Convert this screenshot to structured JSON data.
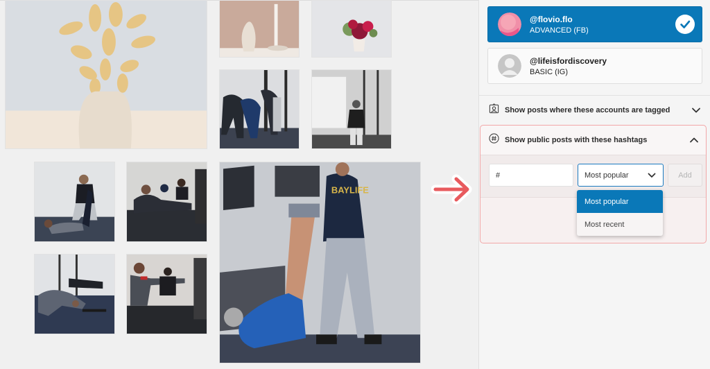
{
  "gallery": {
    "tiles": [
      {
        "name": "pampas-vase-photo"
      },
      {
        "name": "vase-candle-photo"
      },
      {
        "name": "flower-bouquet-photo"
      },
      {
        "name": "gym-stretch-group-photo"
      },
      {
        "name": "whiteboard-trainer-photo"
      },
      {
        "name": "assisted-stretch-photo"
      },
      {
        "name": "seated-reach-photo"
      },
      {
        "name": "trainer-leg-stretch-photo",
        "shirt_text": "BAYLIFE"
      },
      {
        "name": "floor-stretch-row-photo"
      },
      {
        "name": "woman-reach-photo"
      }
    ]
  },
  "accounts": [
    {
      "handle": "@flovio.flo",
      "type": "ADVANCED (FB)",
      "selected": true
    },
    {
      "handle": "@lifeisfordiscovery",
      "type": "BASIC (IG)",
      "selected": false
    }
  ],
  "sections": {
    "tagged": {
      "label": "Show posts where these accounts are tagged",
      "icon": "tagged-user-icon",
      "expanded": false
    },
    "hashtags": {
      "label": "Show public posts with these hashtags",
      "icon": "hashtag-icon",
      "expanded": true,
      "input_value": "#",
      "sort_selected": "Most popular",
      "sort_options": [
        "Most popular",
        "Most recent"
      ],
      "add_label": "Add"
    }
  },
  "colors": {
    "accent": "#0a78b8",
    "highlight_border": "#f2a7a8",
    "arrow": "#e85a5e"
  }
}
